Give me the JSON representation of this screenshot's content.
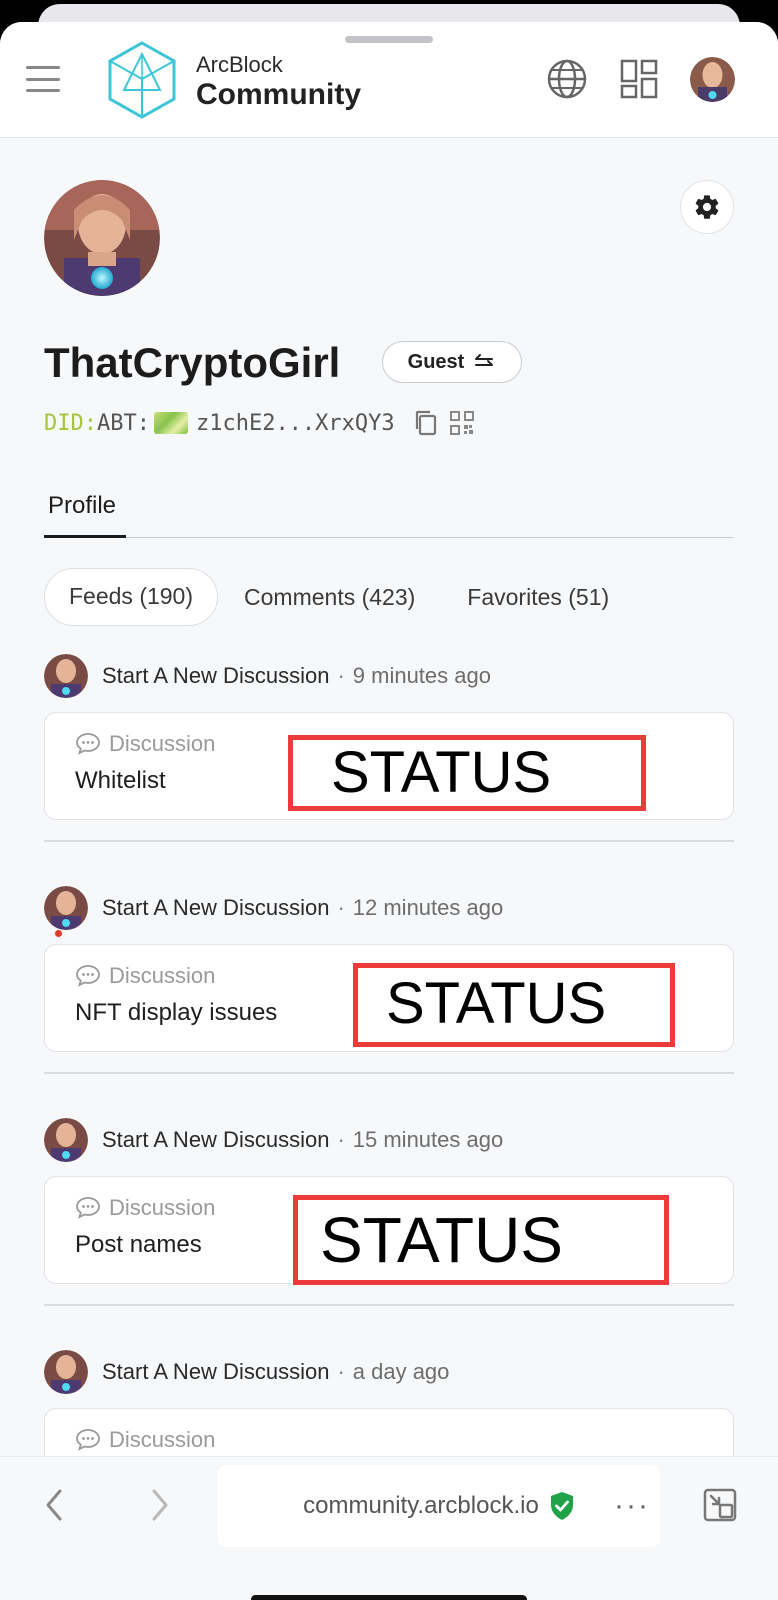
{
  "header": {
    "brand_top": "ArcBlock",
    "brand_bottom": "Community",
    "menu_icon": "hamburger-menu-icon",
    "language_icon": "globe-icon",
    "apps_icon": "grid-apps-icon"
  },
  "profile": {
    "username": "ThatCryptoGirl",
    "role": "Guest",
    "role_icon": "swap-arrows-icon",
    "did_prefix": "DID:",
    "did_chain": "ABT:",
    "did_value": "z1chE2...XrxQY3",
    "settings_icon": "gear-icon"
  },
  "tabs": {
    "main": [
      {
        "label": "Profile",
        "active": true
      }
    ],
    "sub": [
      {
        "label": "Feeds (190)",
        "active": true
      },
      {
        "label": "Comments (423)",
        "active": false
      },
      {
        "label": "Favorites (51)",
        "active": false
      }
    ]
  },
  "feeds": [
    {
      "action": "Start A New Discussion",
      "separator": "·",
      "time": "9 minutes ago",
      "type": "Discussion",
      "title": "Whitelist",
      "status": "STATUS",
      "unread": false
    },
    {
      "action": "Start A New Discussion",
      "separator": "·",
      "time": "12 minutes ago",
      "type": "Discussion",
      "title": "NFT display issues",
      "status": "STATUS",
      "unread": true
    },
    {
      "action": "Start A New Discussion",
      "separator": "·",
      "time": "15 minutes ago",
      "type": "Discussion",
      "title": "Post names",
      "status": "STATUS",
      "unread": false
    },
    {
      "action": "Start A New Discussion",
      "separator": "·",
      "time": "a day ago",
      "type": "Discussion",
      "title": "",
      "status": "",
      "unread": false
    }
  ],
  "browser": {
    "url": "community.arcblock.io",
    "more_label": "···",
    "secure_icon": "shield-check-icon"
  },
  "colors": {
    "status_border": "#ec3b3b",
    "did_prefix": "#a8c43c",
    "secure_green": "#1fa34a",
    "logo_cyan": "#3cc6d8"
  }
}
